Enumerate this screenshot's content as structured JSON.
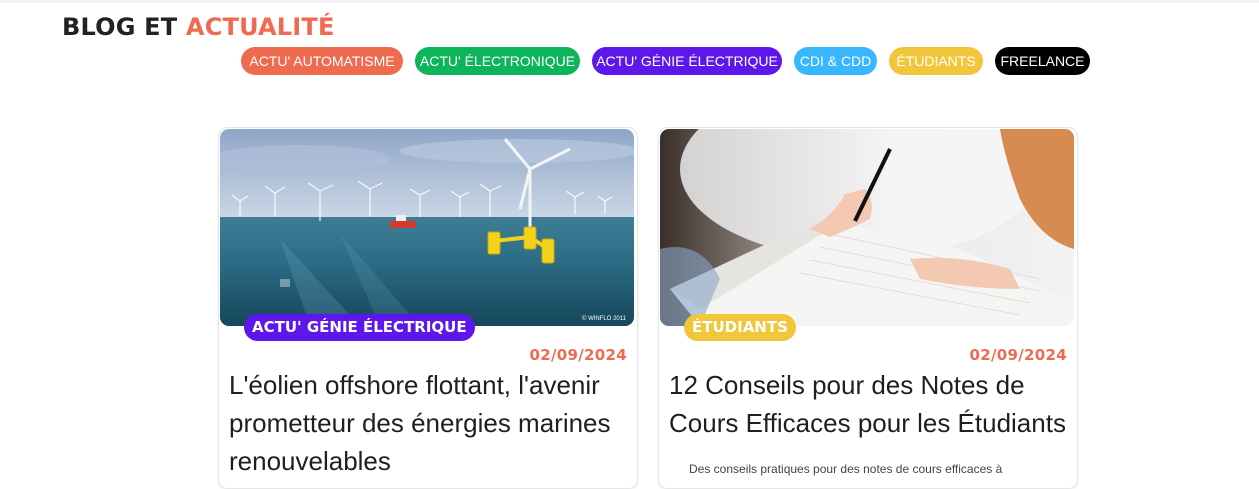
{
  "header": {
    "title_main": "BLOG ET ",
    "title_accent": "ACTUALITÉ"
  },
  "categories": [
    {
      "label": "ACTU' AUTOMATISME",
      "color": "#ee6b50"
    },
    {
      "label": "ACTU' ÉLECTRONIQUE",
      "color": "#0db55a"
    },
    {
      "label": "ACTU' GÉNIE ÉLECTRIQUE",
      "color": "#5e17eb"
    },
    {
      "label": "CDI & CDD",
      "color": "#38b6ff"
    },
    {
      "label": "ÉTUDIANTS",
      "color": "#f2c63a"
    },
    {
      "label": "FREELANCE",
      "color": "#000000"
    }
  ],
  "posts": [
    {
      "category": "ACTU' GÉNIE ÉLECTRIQUE",
      "category_color": "#5e17eb",
      "date": "02/09/2024",
      "title": "L'éolien offshore flottant, l'avenir prometteur des énergies marines renouvelables",
      "image_credit": "© WINFLO 2011"
    },
    {
      "category": "ÉTUDIANTS",
      "category_color": "#f2c63a",
      "date": "02/09/2024",
      "title": "12 Conseils pour des Notes de Cours Efficaces pour les Étudiants",
      "excerpt": "Des conseils pratiques pour des notes de cours efficaces à"
    }
  ]
}
